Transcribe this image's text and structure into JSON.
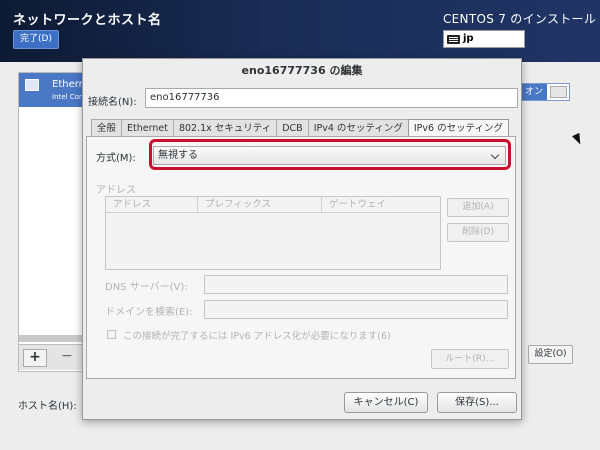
{
  "header": {
    "title": "ネットワークとホスト名",
    "done_label": "完了(D)",
    "install_title": "CENTOS 7 のインストール",
    "keyboard_layout": "jp"
  },
  "background": {
    "connection_name": "Ethernet",
    "connection_desc": "Intel Corporation",
    "toggle_label": "オン",
    "add_label": "+",
    "remove_label": "−",
    "settings_label": "設定(O)",
    "hostname_label": "ホスト名(H):"
  },
  "dialog": {
    "title": "eno16777736 の編集",
    "connection_name_label": "接続名(N):",
    "connection_name_value": "eno16777736",
    "tabs": [
      {
        "label": "全般"
      },
      {
        "label": "Ethernet"
      },
      {
        "label": "802.1x セキュリティ"
      },
      {
        "label": "DCB"
      },
      {
        "label": "IPv4 のセッティング"
      },
      {
        "label": "IPv6 のセッティング"
      }
    ],
    "active_tab": "IPv6 のセッティング",
    "method_label": "方式(M):",
    "method_value": "無視する",
    "address_label": "アドレス",
    "columns": [
      "アドレス",
      "プレフィックス",
      "ゲートウェイ"
    ],
    "add_button": "追加(A)",
    "delete_button": "削除(D)",
    "dns_label": "DNS サーバー(V):",
    "domain_label": "ドメインを検索(E):",
    "require_ipv6_label": "この接続が完了するには IPv6 アドレス化が必要になります(6)",
    "route_button": "ルート(R)…",
    "cancel_button": "キャンセル(C)",
    "save_button": "保存(S)..."
  },
  "colors": {
    "highlight": "#c8102e",
    "accent": "#4a78c4"
  }
}
